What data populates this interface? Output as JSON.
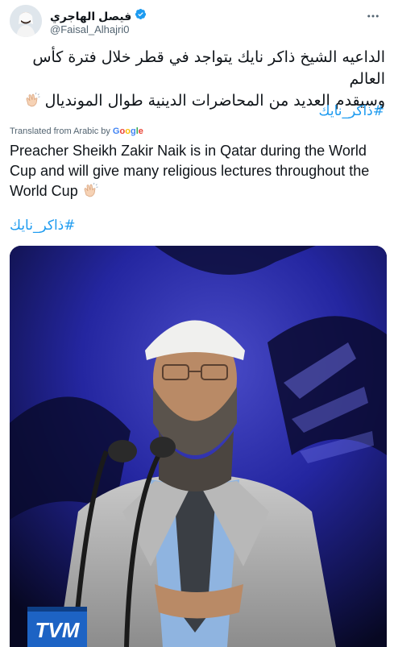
{
  "author": {
    "display_name": "فيصل الهاجري",
    "handle": "@Faisal_Alhajri0"
  },
  "tweet": {
    "arabic_line1": "الداعيه الشيخ ذاكر نايك يتواجد في قطر خلال فترة كأس العالم",
    "arabic_line2": "وسيقدم العديد من المحاضرات الدينية طوال المونديال",
    "hashtag_top": "#ذاكر_نايك",
    "translated_label": "Translated from Arabic by",
    "google_label": "Google",
    "english_text": "Preacher Sheikh Zakir Naik is in Qatar during the World Cup and will give many religious lectures throughout the World Cup",
    "hashtag_bottom": "#ذاكر_نايك"
  },
  "photo": {
    "logo_text": "TVM"
  },
  "icons": [
    "verified-badge-icon",
    "more-options-icon",
    "clapping-hands-icon"
  ],
  "colors": {
    "link": "#1d9bf0",
    "text": "#0f1419",
    "secondary": "#536471",
    "verified": "#1d9bf0"
  }
}
